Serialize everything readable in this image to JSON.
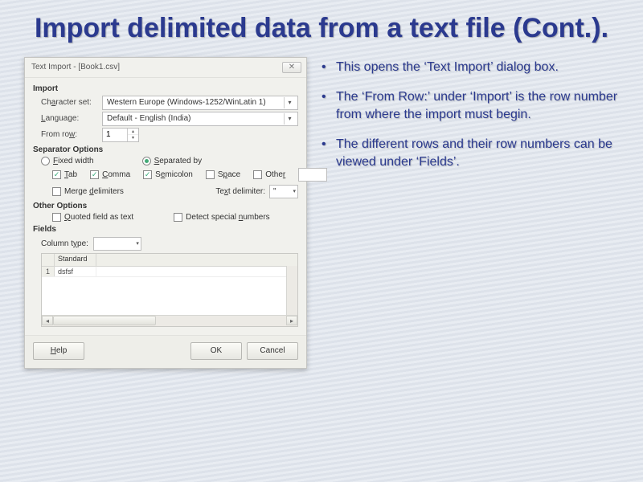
{
  "slide": {
    "title": "Import delimited data from a text file (Cont.)."
  },
  "dialog": {
    "title": "Text Import - [Book1.csv]",
    "section_import": "Import",
    "charset_label": "Character set:",
    "charset_value": "Western Europe (Windows-1252/WinLatin 1)",
    "language_label": "Language:",
    "language_value": "Default - English (India)",
    "fromrow_label": "From row:",
    "fromrow_value": "1",
    "section_separator": "Separator Options",
    "radio_fixed": "Fixed width",
    "radio_sep": "Separated by",
    "chk_tab": "Tab",
    "chk_comma": "Comma",
    "chk_semicolon": "Semicolon",
    "chk_space": "Space",
    "chk_other": "Other",
    "chk_merge": "Merge delimiters",
    "textdelim_label": "Text delimiter:",
    "textdelim_value": "\"",
    "section_other": "Other Options",
    "chk_quoted": "Quoted field as text",
    "chk_detect": "Detect special numbers",
    "section_fields": "Fields",
    "coltype_label": "Column type:",
    "col_header": "Standard",
    "row1_num": "1",
    "row1_cell": "dsfsf",
    "btn_help": "Help",
    "btn_ok": "OK",
    "btn_cancel": "Cancel"
  },
  "bullets": {
    "b1": "This opens the ‘Text Import’ dialog box.",
    "b2": "The ‘From Row:’ under ‘Import’ is the row number from where the import must begin.",
    "b3": "The different rows and their row numbers can be viewed under ‘Fields’."
  }
}
